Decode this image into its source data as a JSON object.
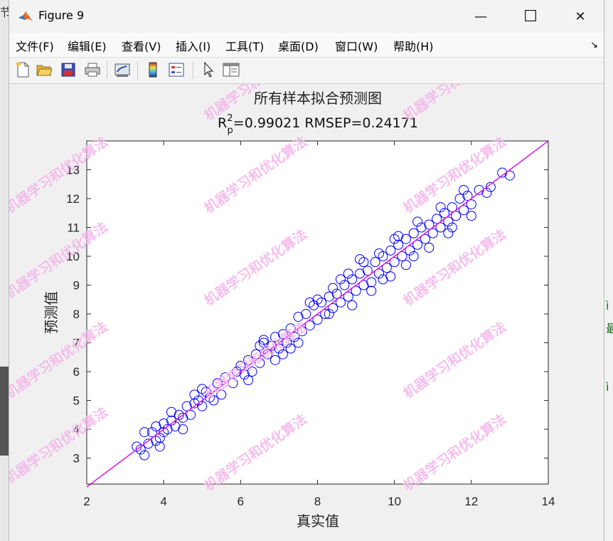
{
  "window": {
    "title": "Figure 9",
    "minimize_glyph": "—",
    "maximize_glyph": "☐",
    "close_glyph": "✕"
  },
  "menu": {
    "items": [
      "文件(F)",
      "编辑(E)",
      "查看(V)",
      "插入(I)",
      "工具(T)",
      "桌面(D)",
      "窗口(W)",
      "帮助(H)"
    ],
    "dock_arrow": "↘"
  },
  "toolbar": {
    "icons": [
      "new-figure-icon",
      "open-file-icon",
      "save-icon",
      "print-icon",
      "link-plot-icon",
      "colorbar-icon",
      "legend-icon",
      "pointer-icon",
      "property-inspector-icon"
    ]
  },
  "background": {
    "left_edge_text": "节",
    "right_edge_texts": [
      "ì",
      "最",
      "ì"
    ]
  },
  "watermark": {
    "text": "机器学习和优化算法",
    "color": "#f4b3ea"
  },
  "chart_data": {
    "type": "scatter",
    "title": "所有样本拟合预测图",
    "subtitle_prefix": "R",
    "subtitle_sup": "2",
    "subtitle_sub": "p",
    "subtitle_rest": "=0.99021  RMSEP=0.24171",
    "xlabel": "真实值",
    "ylabel": "预测值",
    "xlim": [
      2,
      14
    ],
    "ylim": [
      2.1,
      14
    ],
    "xticks": [
      2,
      4,
      6,
      8,
      10,
      12,
      14
    ],
    "yticks": [
      3,
      4,
      5,
      6,
      7,
      8,
      9,
      10,
      11,
      12,
      13
    ],
    "marker_color": "#0000ff",
    "reference_line_color": "#e020e0",
    "reference_line": {
      "x": [
        2,
        14
      ],
      "y": [
        2,
        14
      ]
    },
    "series": [
      {
        "marker": "circle",
        "points": [
          [
            3.3,
            3.4
          ],
          [
            3.4,
            3.3
          ],
          [
            3.5,
            3.1
          ],
          [
            3.5,
            3.9
          ],
          [
            3.6,
            3.5
          ],
          [
            3.7,
            3.9
          ],
          [
            3.8,
            3.6
          ],
          [
            3.8,
            4.1
          ],
          [
            3.9,
            3.7
          ],
          [
            4.0,
            4.2
          ],
          [
            4.0,
            3.9
          ],
          [
            4.1,
            4.0
          ],
          [
            4.2,
            4.3
          ],
          [
            4.3,
            4.1
          ],
          [
            4.4,
            4.5
          ],
          [
            4.5,
            4.4
          ],
          [
            4.6,
            4.8
          ],
          [
            4.7,
            4.5
          ],
          [
            4.8,
            4.9
          ],
          [
            4.9,
            5.0
          ],
          [
            5.0,
            4.8
          ],
          [
            5.1,
            5.3
          ],
          [
            5.2,
            5.1
          ],
          [
            5.4,
            5.6
          ],
          [
            5.5,
            5.2
          ],
          [
            5.6,
            5.8
          ],
          [
            5.8,
            5.6
          ],
          [
            5.9,
            6.0
          ],
          [
            6.0,
            6.2
          ],
          [
            6.1,
            5.9
          ],
          [
            6.2,
            6.4
          ],
          [
            6.3,
            6.0
          ],
          [
            6.4,
            6.6
          ],
          [
            6.5,
            6.3
          ],
          [
            6.6,
            7.0
          ],
          [
            6.7,
            6.6
          ],
          [
            6.8,
            6.9
          ],
          [
            6.9,
            7.2
          ],
          [
            7.0,
            6.8
          ],
          [
            7.1,
            7.3
          ],
          [
            7.2,
            7.0
          ],
          [
            7.3,
            7.5
          ],
          [
            7.4,
            7.2
          ],
          [
            7.5,
            7.9
          ],
          [
            7.6,
            7.4
          ],
          [
            7.7,
            8.0
          ],
          [
            7.8,
            7.6
          ],
          [
            7.9,
            8.3
          ],
          [
            8.0,
            7.8
          ],
          [
            8.1,
            8.4
          ],
          [
            8.2,
            8.0
          ],
          [
            8.3,
            8.6
          ],
          [
            8.4,
            8.2
          ],
          [
            8.5,
            8.7
          ],
          [
            8.6,
            8.4
          ],
          [
            8.7,
            9.0
          ],
          [
            8.8,
            8.6
          ],
          [
            8.9,
            9.2
          ],
          [
            9.0,
            8.8
          ],
          [
            9.1,
            9.4
          ],
          [
            9.2,
            9.0
          ],
          [
            9.3,
            9.5
          ],
          [
            9.4,
            9.1
          ],
          [
            9.5,
            9.8
          ],
          [
            9.6,
            9.4
          ],
          [
            9.7,
            10.0
          ],
          [
            9.8,
            9.6
          ],
          [
            9.9,
            10.2
          ],
          [
            10.0,
            9.8
          ],
          [
            10.1,
            10.4
          ],
          [
            10.2,
            10.0
          ],
          [
            10.3,
            10.6
          ],
          [
            10.4,
            10.2
          ],
          [
            10.5,
            10.8
          ],
          [
            10.6,
            10.4
          ],
          [
            10.7,
            11.0
          ],
          [
            10.8,
            10.6
          ],
          [
            10.9,
            11.1
          ],
          [
            11.0,
            10.8
          ],
          [
            11.1,
            11.3
          ],
          [
            11.2,
            11.0
          ],
          [
            11.3,
            11.5
          ],
          [
            11.4,
            11.2
          ],
          [
            11.5,
            11.7
          ],
          [
            11.6,
            11.4
          ],
          [
            11.7,
            12.0
          ],
          [
            11.8,
            11.6
          ],
          [
            11.9,
            12.1
          ],
          [
            12.0,
            11.8
          ],
          [
            12.2,
            12.3
          ],
          [
            12.4,
            12.2
          ],
          [
            12.5,
            12.4
          ],
          [
            12.8,
            12.9
          ],
          [
            13.0,
            12.8
          ],
          [
            3.9,
            3.4
          ],
          [
            4.5,
            4.0
          ],
          [
            4.2,
            4.6
          ],
          [
            5.3,
            5.0
          ],
          [
            5.0,
            5.4
          ],
          [
            6.2,
            5.7
          ],
          [
            6.5,
            6.9
          ],
          [
            6.9,
            6.4
          ],
          [
            7.3,
            6.8
          ],
          [
            7.5,
            7.0
          ],
          [
            7.8,
            8.4
          ],
          [
            8.0,
            8.5
          ],
          [
            8.3,
            8.0
          ],
          [
            8.6,
            9.2
          ],
          [
            8.9,
            8.3
          ],
          [
            9.2,
            9.8
          ],
          [
            9.4,
            8.8
          ],
          [
            9.6,
            10.1
          ],
          [
            9.9,
            9.3
          ],
          [
            10.1,
            10.7
          ],
          [
            10.3,
            9.7
          ],
          [
            10.6,
            11.2
          ],
          [
            10.9,
            10.3
          ],
          [
            11.2,
            11.7
          ],
          [
            11.5,
            11.0
          ],
          [
            11.8,
            12.3
          ],
          [
            12.0,
            11.4
          ],
          [
            11.4,
            10.8
          ],
          [
            9.1,
            9.9
          ],
          [
            8.8,
            9.4
          ],
          [
            7.1,
            6.6
          ],
          [
            6.6,
            7.1
          ],
          [
            4.8,
            5.2
          ],
          [
            10.5,
            10.0
          ],
          [
            10.0,
            10.6
          ],
          [
            9.7,
            9.2
          ],
          [
            8.4,
            8.9
          ]
        ]
      }
    ]
  }
}
